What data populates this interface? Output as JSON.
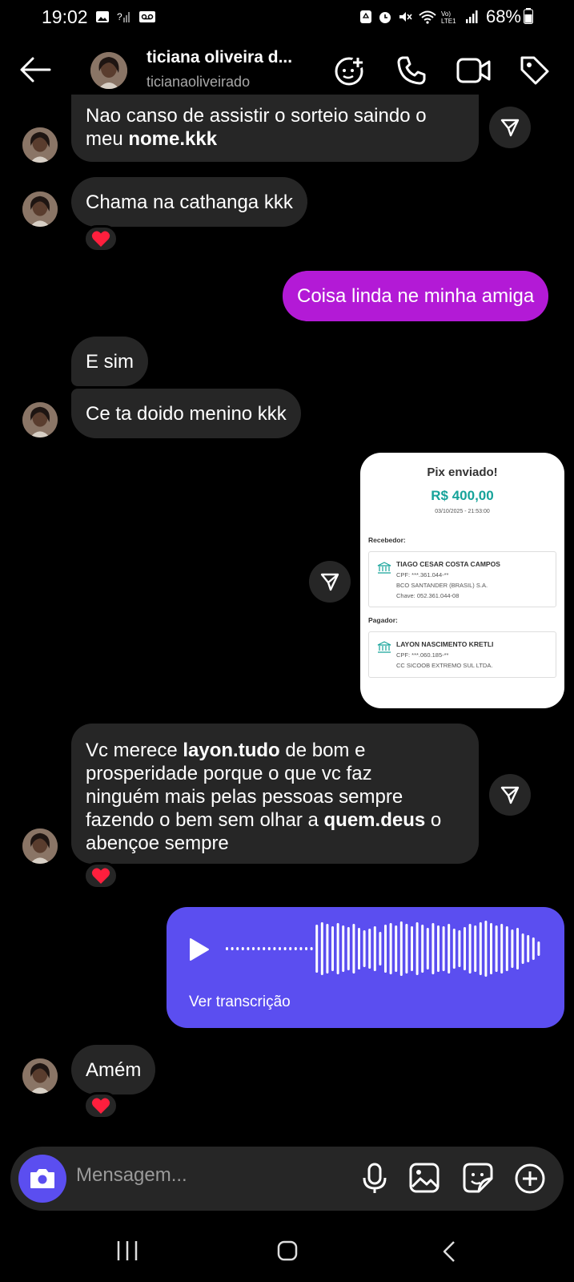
{
  "status_bar": {
    "time": "19:02",
    "battery": "68%"
  },
  "header": {
    "title": "ticiana oliveira d...",
    "username": "ticianaoliveirado"
  },
  "messages": [
    {
      "text_parts": [
        "Nao canso de assistir o sorteio saindo o\nmeu ",
        "nome.kkk",
        ""
      ]
    },
    {
      "text": "Chama na cathanga kkk"
    },
    {
      "text": "Coisa linda ne minha amiga"
    },
    {
      "text": "E sim"
    },
    {
      "text": "Ce ta doido menino kkk"
    },
    {
      "text_parts": [
        "Vc merece ",
        "layon.tudo",
        " de bom e\nprosperidade porque o que vc faz\nninguém mais pelas pessoas sempre\nfazendo o bem sem olhar a ",
        "quem.deus",
        " o\nabençoe sempre"
      ]
    },
    {
      "text": "Amém"
    }
  ],
  "receipt": {
    "title": "Pix enviado!",
    "amount": "R$ 400,00",
    "date": "03/10/2025 - 21:53:00",
    "recebedor_label": "Recebedor:",
    "recebedor": {
      "name": "TIAGO CESAR COSTA CAMPOS",
      "cpf": "CPF: ***.361.044-**",
      "bank": "BCO SANTANDER (BRASIL) S.A.",
      "chave": "Chave: 052.361.044-08"
    },
    "pagador_label": "Pagador:",
    "pagador": {
      "name": "LAYON NASCIMENTO KRETLI",
      "cpf": "CPF: ***.060.185-**",
      "bank": "CC SICOOB EXTREMO SUL LTDA."
    }
  },
  "audio": {
    "transcript_label": "Ver transcrição"
  },
  "composer": {
    "placeholder": "Mensagem..."
  },
  "colors": {
    "incoming_bubble": "#262626",
    "outgoing_bubble": "#b31ad6",
    "audio_bubble": "#5b4ef0",
    "reaction_heart": "#ff1f3d",
    "pix_amount": "#16a39a"
  },
  "icons": [
    "back-arrow-icon",
    "add-effect-icon",
    "phone-icon",
    "video-icon",
    "tag-icon",
    "share-icon",
    "heart-icon",
    "play-icon",
    "camera-icon",
    "microphone-icon",
    "gallery-icon",
    "sticker-icon",
    "plus-circle-icon",
    "nav-recents-icon",
    "nav-home-icon",
    "nav-back-icon"
  ]
}
